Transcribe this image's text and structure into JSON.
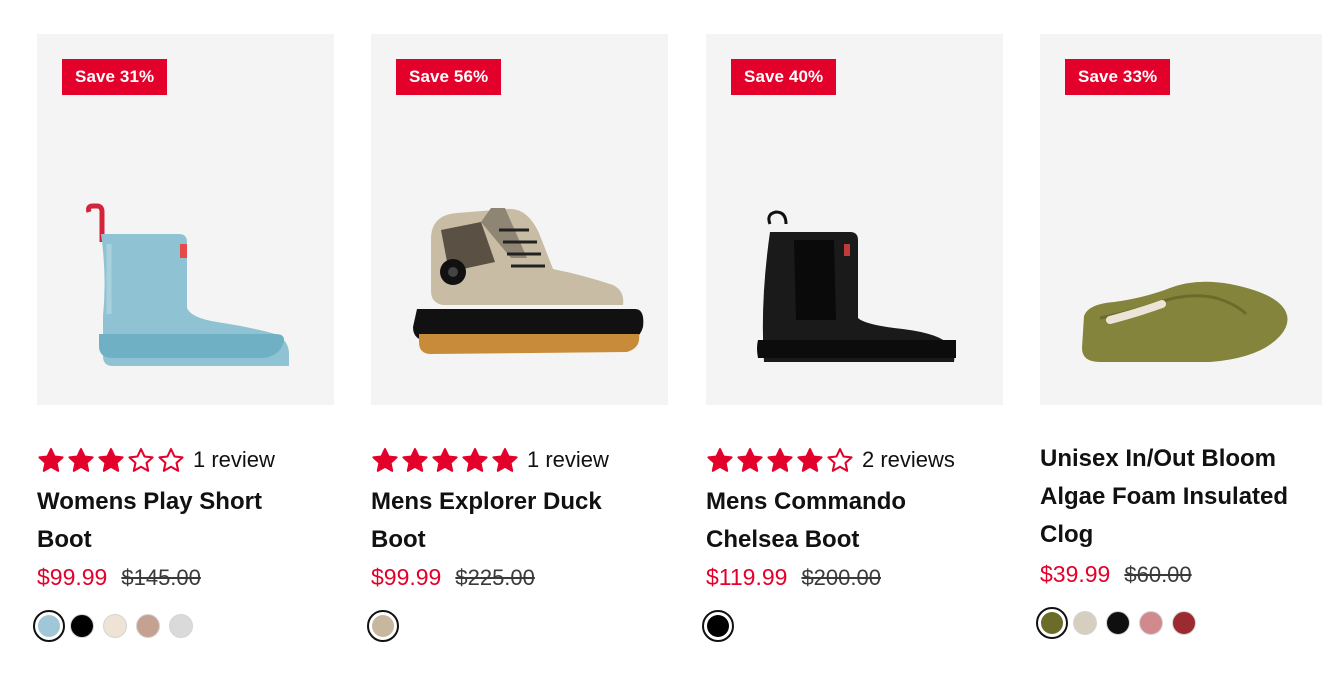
{
  "products": [
    {
      "badge": "Save 31%",
      "rating": 3,
      "review_text": "1 review",
      "title": "Womens Play Short Boot",
      "sale_price": "$99.99",
      "original_price": "$145.00",
      "swatches": [
        "#9fc7d8",
        "#000000",
        "#efe3d6",
        "#c4a190",
        "#dadada"
      ],
      "selected_swatch": 0
    },
    {
      "badge": "Save 56%",
      "rating": 5,
      "review_text": "1 review",
      "title": "Mens Explorer Duck Boot",
      "sale_price": "$99.99",
      "original_price": "$225.00",
      "swatches": [
        "#c8b79f"
      ],
      "selected_swatch": 0
    },
    {
      "badge": "Save 40%",
      "rating": 4,
      "review_text": "2 reviews",
      "title": "Mens Commando Chelsea Boot",
      "sale_price": "$119.99",
      "original_price": "$200.00",
      "swatches": [
        "#000000"
      ],
      "selected_swatch": 0
    },
    {
      "badge": "Save 33%",
      "rating": null,
      "review_text": "",
      "title": "Unisex In/Out Bloom Algae Foam Insulated Clog",
      "sale_price": "$39.99",
      "original_price": "$60.00",
      "swatches": [
        "#6b6b2a",
        "#d6cfc0",
        "#0f0f0f",
        "#d08a8d",
        "#9b2a31"
      ],
      "selected_swatch": 0
    }
  ],
  "colors": {
    "badge_bg": "#e3002b",
    "star": "#e3002b",
    "sale_price": "#e3002b"
  }
}
